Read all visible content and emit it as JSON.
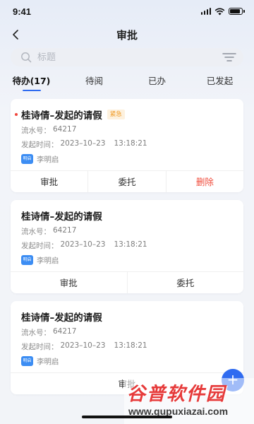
{
  "status_bar": {
    "time": "9:41",
    "battery_level": 0.9
  },
  "nav": {
    "title": "审批",
    "back_icon": "chevron-left-icon"
  },
  "search": {
    "placeholder": "标题",
    "value": "",
    "filter_icon": "filter-icon"
  },
  "tabs": [
    {
      "label": "待办(17)",
      "active": true
    },
    {
      "label": "待阅",
      "active": false
    },
    {
      "label": "已办",
      "active": false
    },
    {
      "label": "已发起",
      "active": false
    }
  ],
  "cards": [
    {
      "title": "桂诗倩–发起的请假",
      "urgent": true,
      "urgent_label": "紧急",
      "serial_label": "流水号：",
      "serial": "64217",
      "time_label": "发起时间：",
      "date": "2023–10–23",
      "time": "13:18:21",
      "avatar_text": "明启",
      "user": "李明启",
      "actions": [
        "审批",
        "委托",
        "删除"
      ]
    },
    {
      "title": "桂诗倩–发起的请假",
      "urgent": false,
      "serial_label": "流水号：",
      "serial": "64217",
      "time_label": "发起时间：",
      "date": "2023–10–23",
      "time": "13:18:21",
      "avatar_text": "明启",
      "user": "李明启",
      "actions": [
        "审批",
        "委托"
      ]
    },
    {
      "title": "桂诗倩–发起的请假",
      "urgent": false,
      "serial_label": "流水号：",
      "serial": "64217",
      "time_label": "发起时间：",
      "date": "2023–10–23",
      "time": "13:18:21",
      "avatar_text": "明启",
      "user": "李明启",
      "actions": [
        "审批"
      ]
    }
  ],
  "watermark": {
    "main": "谷普软件园",
    "sub": "www.gupuxiazai.com"
  },
  "colors": {
    "accent": "#2f6bf0",
    "danger": "#f04a3a",
    "urgent_badge": "#f09a24"
  }
}
